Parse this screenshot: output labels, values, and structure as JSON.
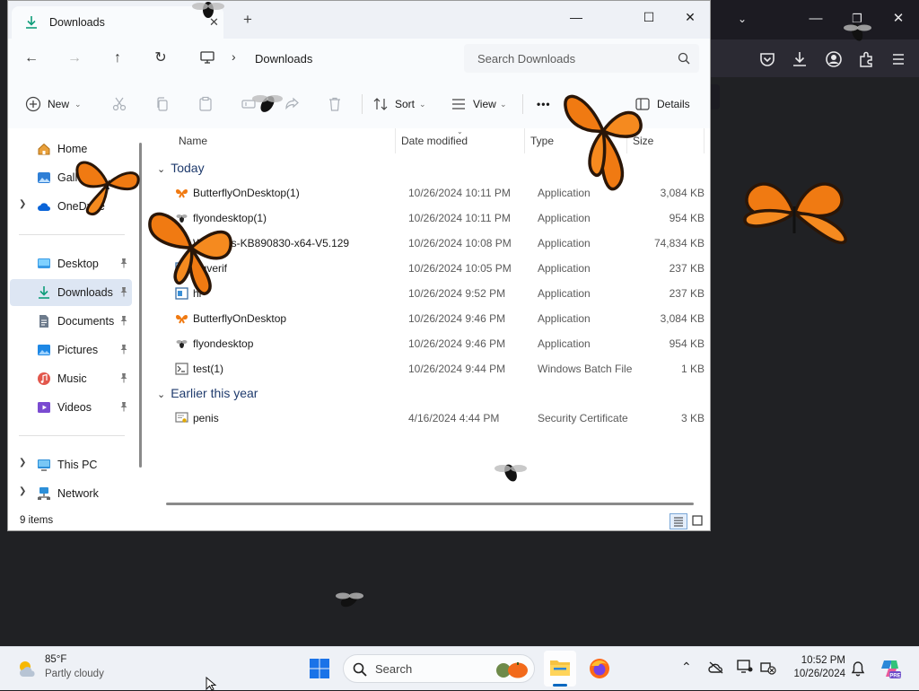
{
  "explorer": {
    "tab_title": "Downloads",
    "new_tab_label": "+",
    "breadcrumb": "Downloads",
    "search_placeholder": "Search Downloads",
    "toolbar": {
      "new_label": "New",
      "sort_label": "Sort",
      "view_label": "View",
      "more_label": "•••",
      "details_label": "Details"
    },
    "sidebar": {
      "items": [
        {
          "label": "Home",
          "icon": "home-icon"
        },
        {
          "label": "Gallery",
          "icon": "gallery-icon"
        },
        {
          "label": "OneDrive",
          "icon": "cloud-icon"
        },
        {
          "label": "Desktop",
          "icon": "desktop-icon"
        },
        {
          "label": "Downloads",
          "icon": "download-icon"
        },
        {
          "label": "Documents",
          "icon": "documents-icon"
        },
        {
          "label": "Pictures",
          "icon": "pictures-icon"
        },
        {
          "label": "Music",
          "icon": "music-icon"
        },
        {
          "label": "Videos",
          "icon": "videos-icon"
        },
        {
          "label": "This PC",
          "icon": "pc-icon"
        },
        {
          "label": "Network",
          "icon": "network-icon"
        }
      ]
    },
    "columns": {
      "name": "Name",
      "date": "Date modified",
      "type": "Type",
      "size": "Size"
    },
    "groups": {
      "today": "Today",
      "earlier": "Earlier this year"
    },
    "files": [
      {
        "name": "ButterflyOnDesktop(1)",
        "date": "10/26/2024 10:11 PM",
        "type": "Application",
        "size": "3,084 KB"
      },
      {
        "name": "flyondesktop(1)",
        "date": "10/26/2024 10:11 PM",
        "type": "Application",
        "size": "954 KB"
      },
      {
        "name": "Windows-KB890830-x64-V5.129",
        "date": "10/26/2024 10:08 PM",
        "type": "Application",
        "size": "74,834 KB"
      },
      {
        "name": "sigverif",
        "date": "10/26/2024 10:05 PM",
        "type": "Application",
        "size": "237 KB"
      },
      {
        "name": "hi",
        "date": "10/26/2024 9:52 PM",
        "type": "Application",
        "size": "237 KB"
      },
      {
        "name": "ButterflyOnDesktop",
        "date": "10/26/2024 9:46 PM",
        "type": "Application",
        "size": "3,084 KB"
      },
      {
        "name": "flyondesktop",
        "date": "10/26/2024 9:46 PM",
        "type": "Application",
        "size": "954 KB"
      },
      {
        "name": "test(1)",
        "date": "10/26/2024 9:44 PM",
        "type": "Windows Batch File",
        "size": "1 KB"
      },
      {
        "name": "penis",
        "date": "4/16/2024 4:44 PM",
        "type": "Security Certificate",
        "size": "3 KB"
      }
    ],
    "status": "9 items"
  },
  "taskbar": {
    "weather_temp": "85°F",
    "weather_condition": "Partly cloudy",
    "search_label": "Search",
    "time": "10:52 PM",
    "date": "10/26/2024"
  },
  "colors": {
    "accent": "#0067c0",
    "selection": "#dde6f3",
    "butterfly": "#f07a12",
    "group_header": "#1f3b6d"
  }
}
